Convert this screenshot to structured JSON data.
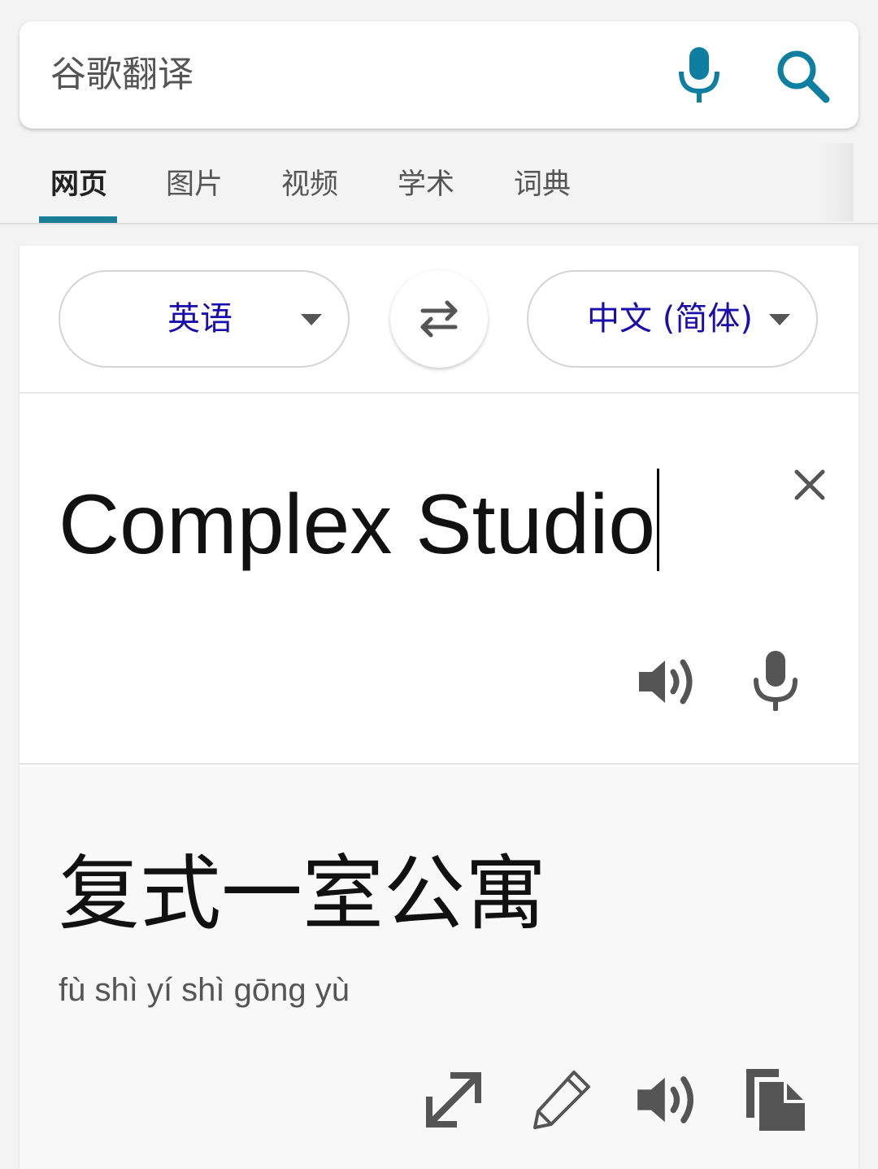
{
  "search": {
    "query": "谷歌翻译",
    "mic_icon": "microphone-icon",
    "search_icon": "search-icon",
    "accent_color": "#0e7fa0"
  },
  "tabs": [
    {
      "label": "网页",
      "active": true
    },
    {
      "label": "图片",
      "active": false
    },
    {
      "label": "视频",
      "active": false
    },
    {
      "label": "学术",
      "active": false
    },
    {
      "label": "词典",
      "active": false
    }
  ],
  "translator": {
    "source_language": "英语",
    "target_language": "中文 (简体)",
    "swap_icon": "swap-arrows-icon",
    "source_text": "Complex Studio",
    "result_text": "复式一室公寓",
    "pinyin": "fù shì yí shì gōng yù",
    "link_color": "#1a0dab",
    "source_actions": [
      "speaker-icon",
      "microphone-icon"
    ],
    "result_actions": [
      "expand-icon",
      "edit-icon",
      "speaker-icon",
      "copy-icon"
    ]
  }
}
